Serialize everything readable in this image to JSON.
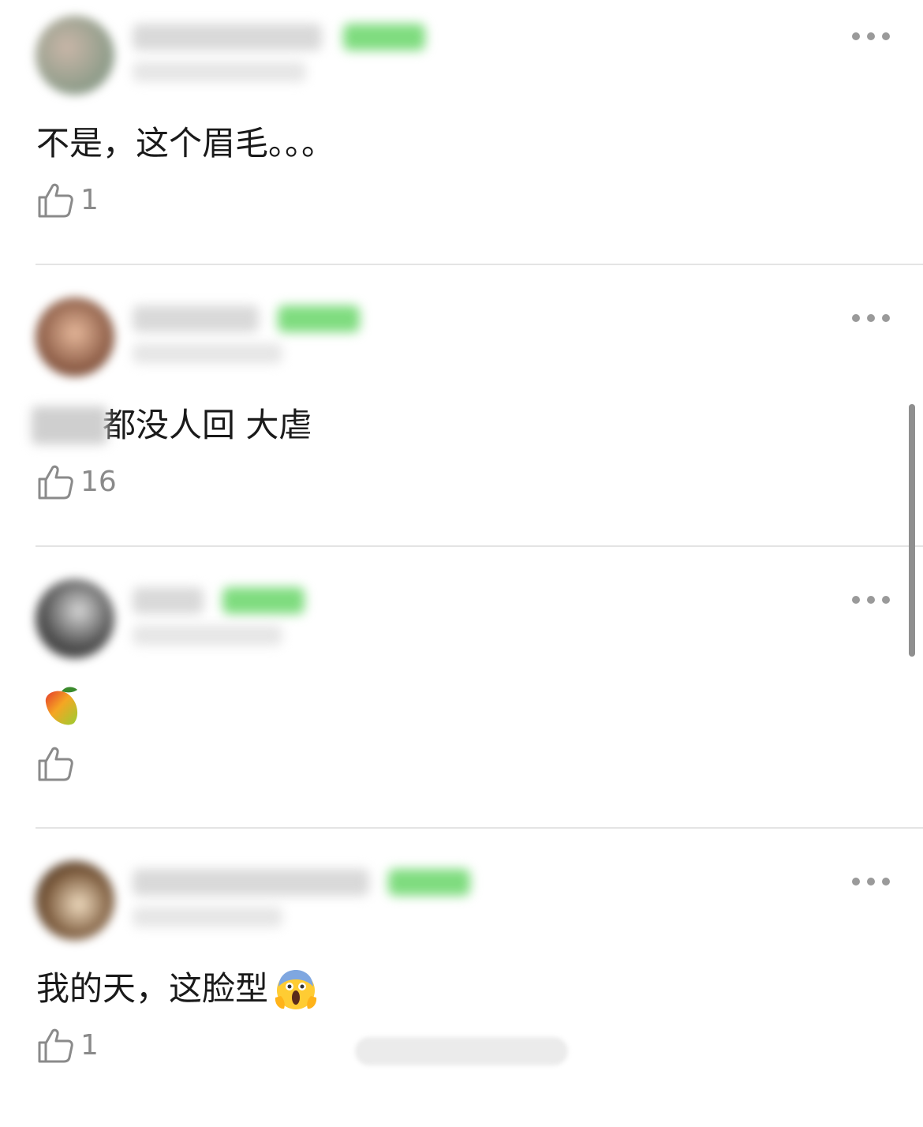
{
  "comments": [
    {
      "text": "不是，这个眉毛。。。",
      "likes": "1"
    },
    {
      "text": "都没人回 大虐",
      "likes": "16"
    },
    {
      "text": "",
      "emoji": "mango-icon",
      "likes": ""
    },
    {
      "text": "我的天，这脸型",
      "emoji": "face-screaming-icon",
      "likes": "1"
    }
  ],
  "colors": {
    "badge": "#7fdc7f",
    "divider": "#e4e4e4",
    "like": "#8a8a8a"
  }
}
